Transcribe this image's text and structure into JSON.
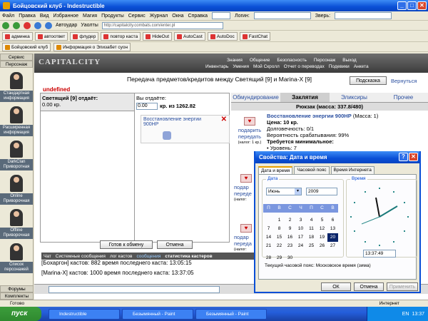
{
  "window": {
    "title": "Бойцовский клуб - Indestructible"
  },
  "menu": [
    "Файл",
    "Правка",
    "Вид",
    "Избранное",
    "Магия",
    "Продукты",
    "Сервис",
    "Журнал",
    "Окна",
    "Справка"
  ],
  "menu_login_label": "Логин:",
  "menu_search_label": "Зверь:",
  "toolbar": {
    "autoudar": "Автоудар",
    "yaolti": "Уаолты",
    "address": "http://capitalcity.combats.com/enter.pl"
  },
  "links": [
    "админка",
    "автоответ",
    "флудер",
    "повтор каста",
    "HideOut",
    "AutoCast",
    "AutoDoc",
    "FastChat"
  ],
  "tabs": [
    "Бойцовский клуб",
    "Информация о Элизабет суон"
  ],
  "sidebar": {
    "head1": "Сервис",
    "head2": "Персонаж",
    "items": [
      "Стандартная информация",
      "Расширенная информация",
      "DarkClan Приворотная",
      "Online Приворочная",
      "Offline Приворочная",
      "Список персонажей"
    ],
    "foot1": "Форумы",
    "foot2": "Комплекты"
  },
  "game": {
    "logo": "CAPITALCITY",
    "topnav1": [
      "Знания",
      "Общение",
      "Безопасность",
      "Персонаж",
      "Выход"
    ],
    "topnav2": [
      "Инвентарь",
      "Умения",
      "Мой Скролл",
      "Отчет о переводах",
      "Подевики",
      "Анкета"
    ],
    "transfer_title": "Передача предметов/кредитов между Светящий [9] и Marina-X [9]",
    "hint_btn": "Подсказка",
    "back_btn": "Вернуться",
    "undefined": "undefined",
    "left_head": "Светящий [9] отдаёт:",
    "left_amount": "0.00 кр.",
    "right_head": "Вы отдаёте:",
    "right_amount_value": "0.00",
    "right_amount_rest": "кр. из 1262.82",
    "item_name": "Восстановление энергии 900HP",
    "exchange_btn": "Готов к обмену",
    "cancel_btn": "Отмена",
    "tabs": [
      "Обмундирование",
      "Заклятия",
      "Эликсиры",
      "Прочее"
    ],
    "backpack": "Рюкзак (масса: 337.8/480)",
    "gift1": "подарить",
    "give1": "передать",
    "tax1": "(налог: 1 кр.)",
    "scroll_name": "Восстановление энергии 900HP",
    "scroll_mass": "(Масса: 1)",
    "price": "Цена: 10 кр.",
    "durability": "Долговечность: 0/1",
    "chance": "Вероятность срабатывания: 99%",
    "req": "Требуется минимальное:",
    "level": "• Уровень: 7",
    "gift2": "подар",
    "give2": "переде",
    "tax2": "(налог:",
    "gift3": "подар",
    "give3": "переда",
    "tax3": "(налог:",
    "chat_tabs": [
      "Чат",
      "Системные сообщения",
      "лог кастов",
      "сообщения",
      "статистика кастеров"
    ],
    "chat_line1": "[Бохаргон] кастов: 882 время последнего каста: 13:05:15",
    "chat_line2": "[Marina-X] кастов: 1000 время последнего каста: 13:37:05"
  },
  "dialog": {
    "title": "Свойства: Дата и время",
    "tabs": [
      "Дата и время",
      "Часовой пояс",
      "Время Интернета"
    ],
    "date_group": "Дата",
    "time_group": "Время",
    "month": "Июнь",
    "year": "2009",
    "weekdays": [
      "П",
      "В",
      "С",
      "Ч",
      "П",
      "С",
      "В"
    ],
    "days": [
      "",
      "1",
      "2",
      "3",
      "4",
      "5",
      "6",
      "7",
      "8",
      "9",
      "10",
      "11",
      "12",
      "13",
      "14",
      "15",
      "16",
      "17",
      "18",
      "19",
      "20",
      "21",
      "22",
      "23",
      "24",
      "25",
      "26",
      "27",
      "28",
      "29",
      "30",
      "",
      "",
      "",
      "",
      ""
    ],
    "selected_day": "20",
    "time": "13:37:49",
    "tz": "Текущий часовой пояс: Московское время (зима)",
    "ok": "ОК",
    "cancel": "Отмена",
    "apply": "Применить"
  },
  "statusbar": {
    "left": "Готово",
    "zone": "Интернет"
  },
  "taskbar": {
    "start": "пуск",
    "tasks": [
      "Indestructible",
      "Безымянный - Paint",
      "Безымянный - Paint"
    ],
    "lang": "EN",
    "clock": "13:37"
  }
}
